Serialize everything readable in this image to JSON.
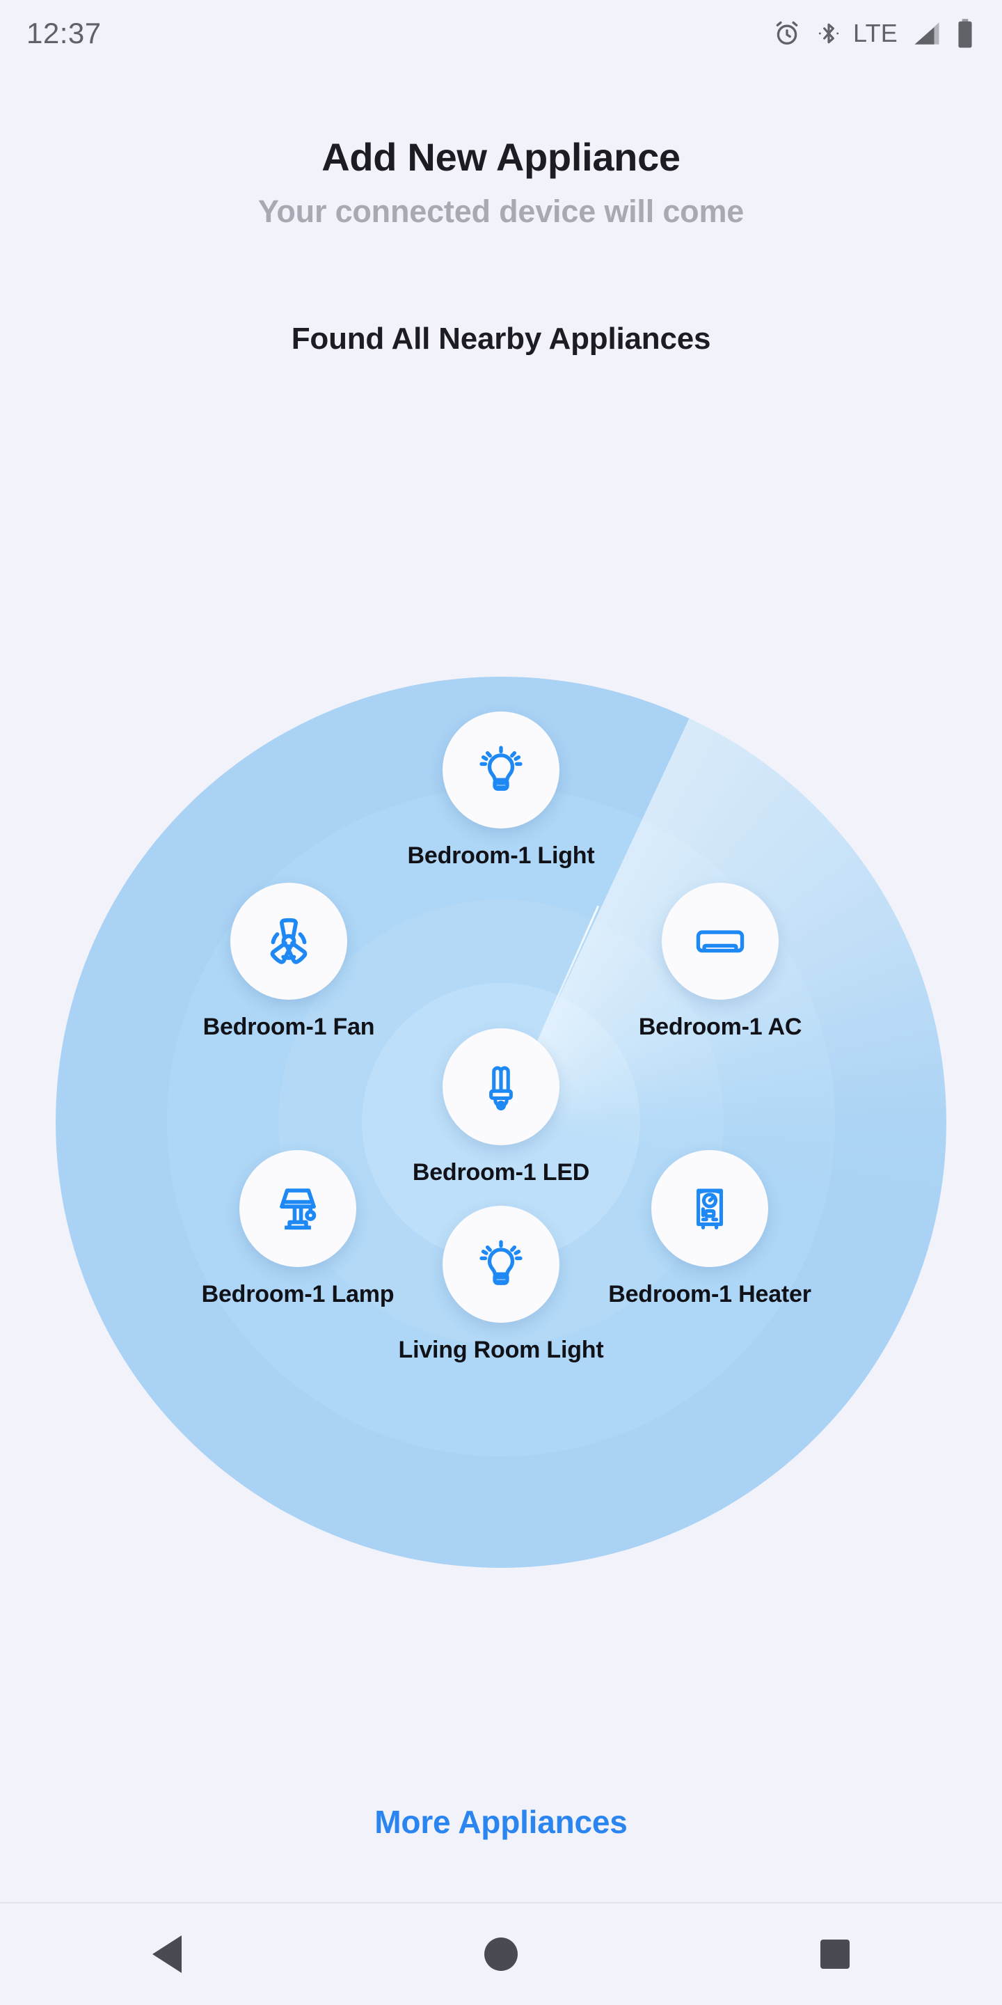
{
  "status_bar": {
    "time": "12:37",
    "network_label": "LTE",
    "icons": [
      "alarm-icon",
      "bluetooth-icon",
      "signal-icon",
      "battery-icon"
    ]
  },
  "header": {
    "title": "Add New Appliance",
    "subtitle": "Your connected device will come"
  },
  "section": {
    "title": "Found All Nearby Appliances"
  },
  "colors": {
    "background": "#f2f2fb",
    "accent": "#2a85f0",
    "icon_blue": "#1e88f5",
    "radar_outer": "#a9d2f4",
    "radar_core": "#bddff9",
    "text_dark": "#1c1c22",
    "text_muted": "#a9a9b3"
  },
  "radar": {
    "rings": 4,
    "sweep_visible": true
  },
  "devices": [
    {
      "id": "bedroom-1-light",
      "label": "Bedroom-1 Light",
      "icon": "light-bulb-icon"
    },
    {
      "id": "bedroom-1-fan",
      "label": "Bedroom-1 Fan",
      "icon": "fan-icon"
    },
    {
      "id": "bedroom-1-ac",
      "label": "Bedroom-1 AC",
      "icon": "air-conditioner-icon"
    },
    {
      "id": "bedroom-1-led",
      "label": "Bedroom-1 LED",
      "icon": "cfl-bulb-icon"
    },
    {
      "id": "bedroom-1-lamp",
      "label": "Bedroom-1 Lamp",
      "icon": "table-lamp-icon"
    },
    {
      "id": "bedroom-1-heater",
      "label": "Bedroom-1 Heater",
      "icon": "water-heater-icon"
    },
    {
      "id": "living-room-light",
      "label": "Living Room Light",
      "icon": "light-bulb-icon"
    }
  ],
  "footer": {
    "more_label": "More Appliances"
  },
  "nav_bar": {
    "back_label": "Back",
    "home_label": "Home",
    "recents_label": "Recents"
  }
}
